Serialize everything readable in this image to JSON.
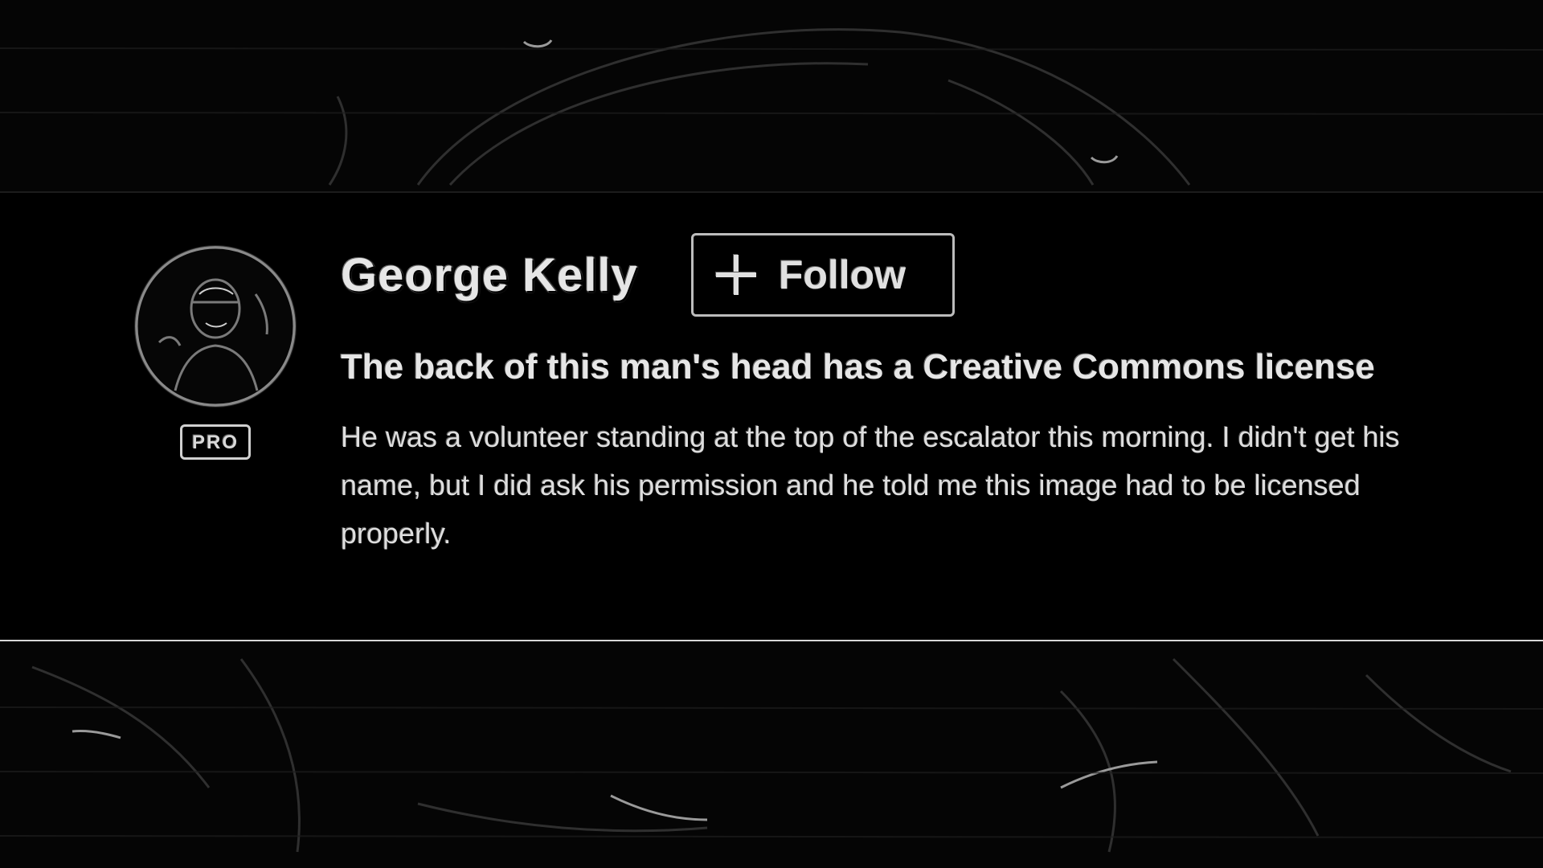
{
  "owner": {
    "name": "George Kelly",
    "badge": "PRO"
  },
  "follow_button": {
    "label": "Follow",
    "icon": "plus-icon"
  },
  "photo": {
    "title": "The back of this man's head has a Creative Commons license",
    "description": "He was a volunteer standing at the top of the escalator this morning. I didn't get his name, but I did ask his permission and he told me this image had to be licensed properly."
  },
  "colors": {
    "background": "#000000",
    "text": "#e6e6e6",
    "panel_border": "#d8d8d8"
  }
}
